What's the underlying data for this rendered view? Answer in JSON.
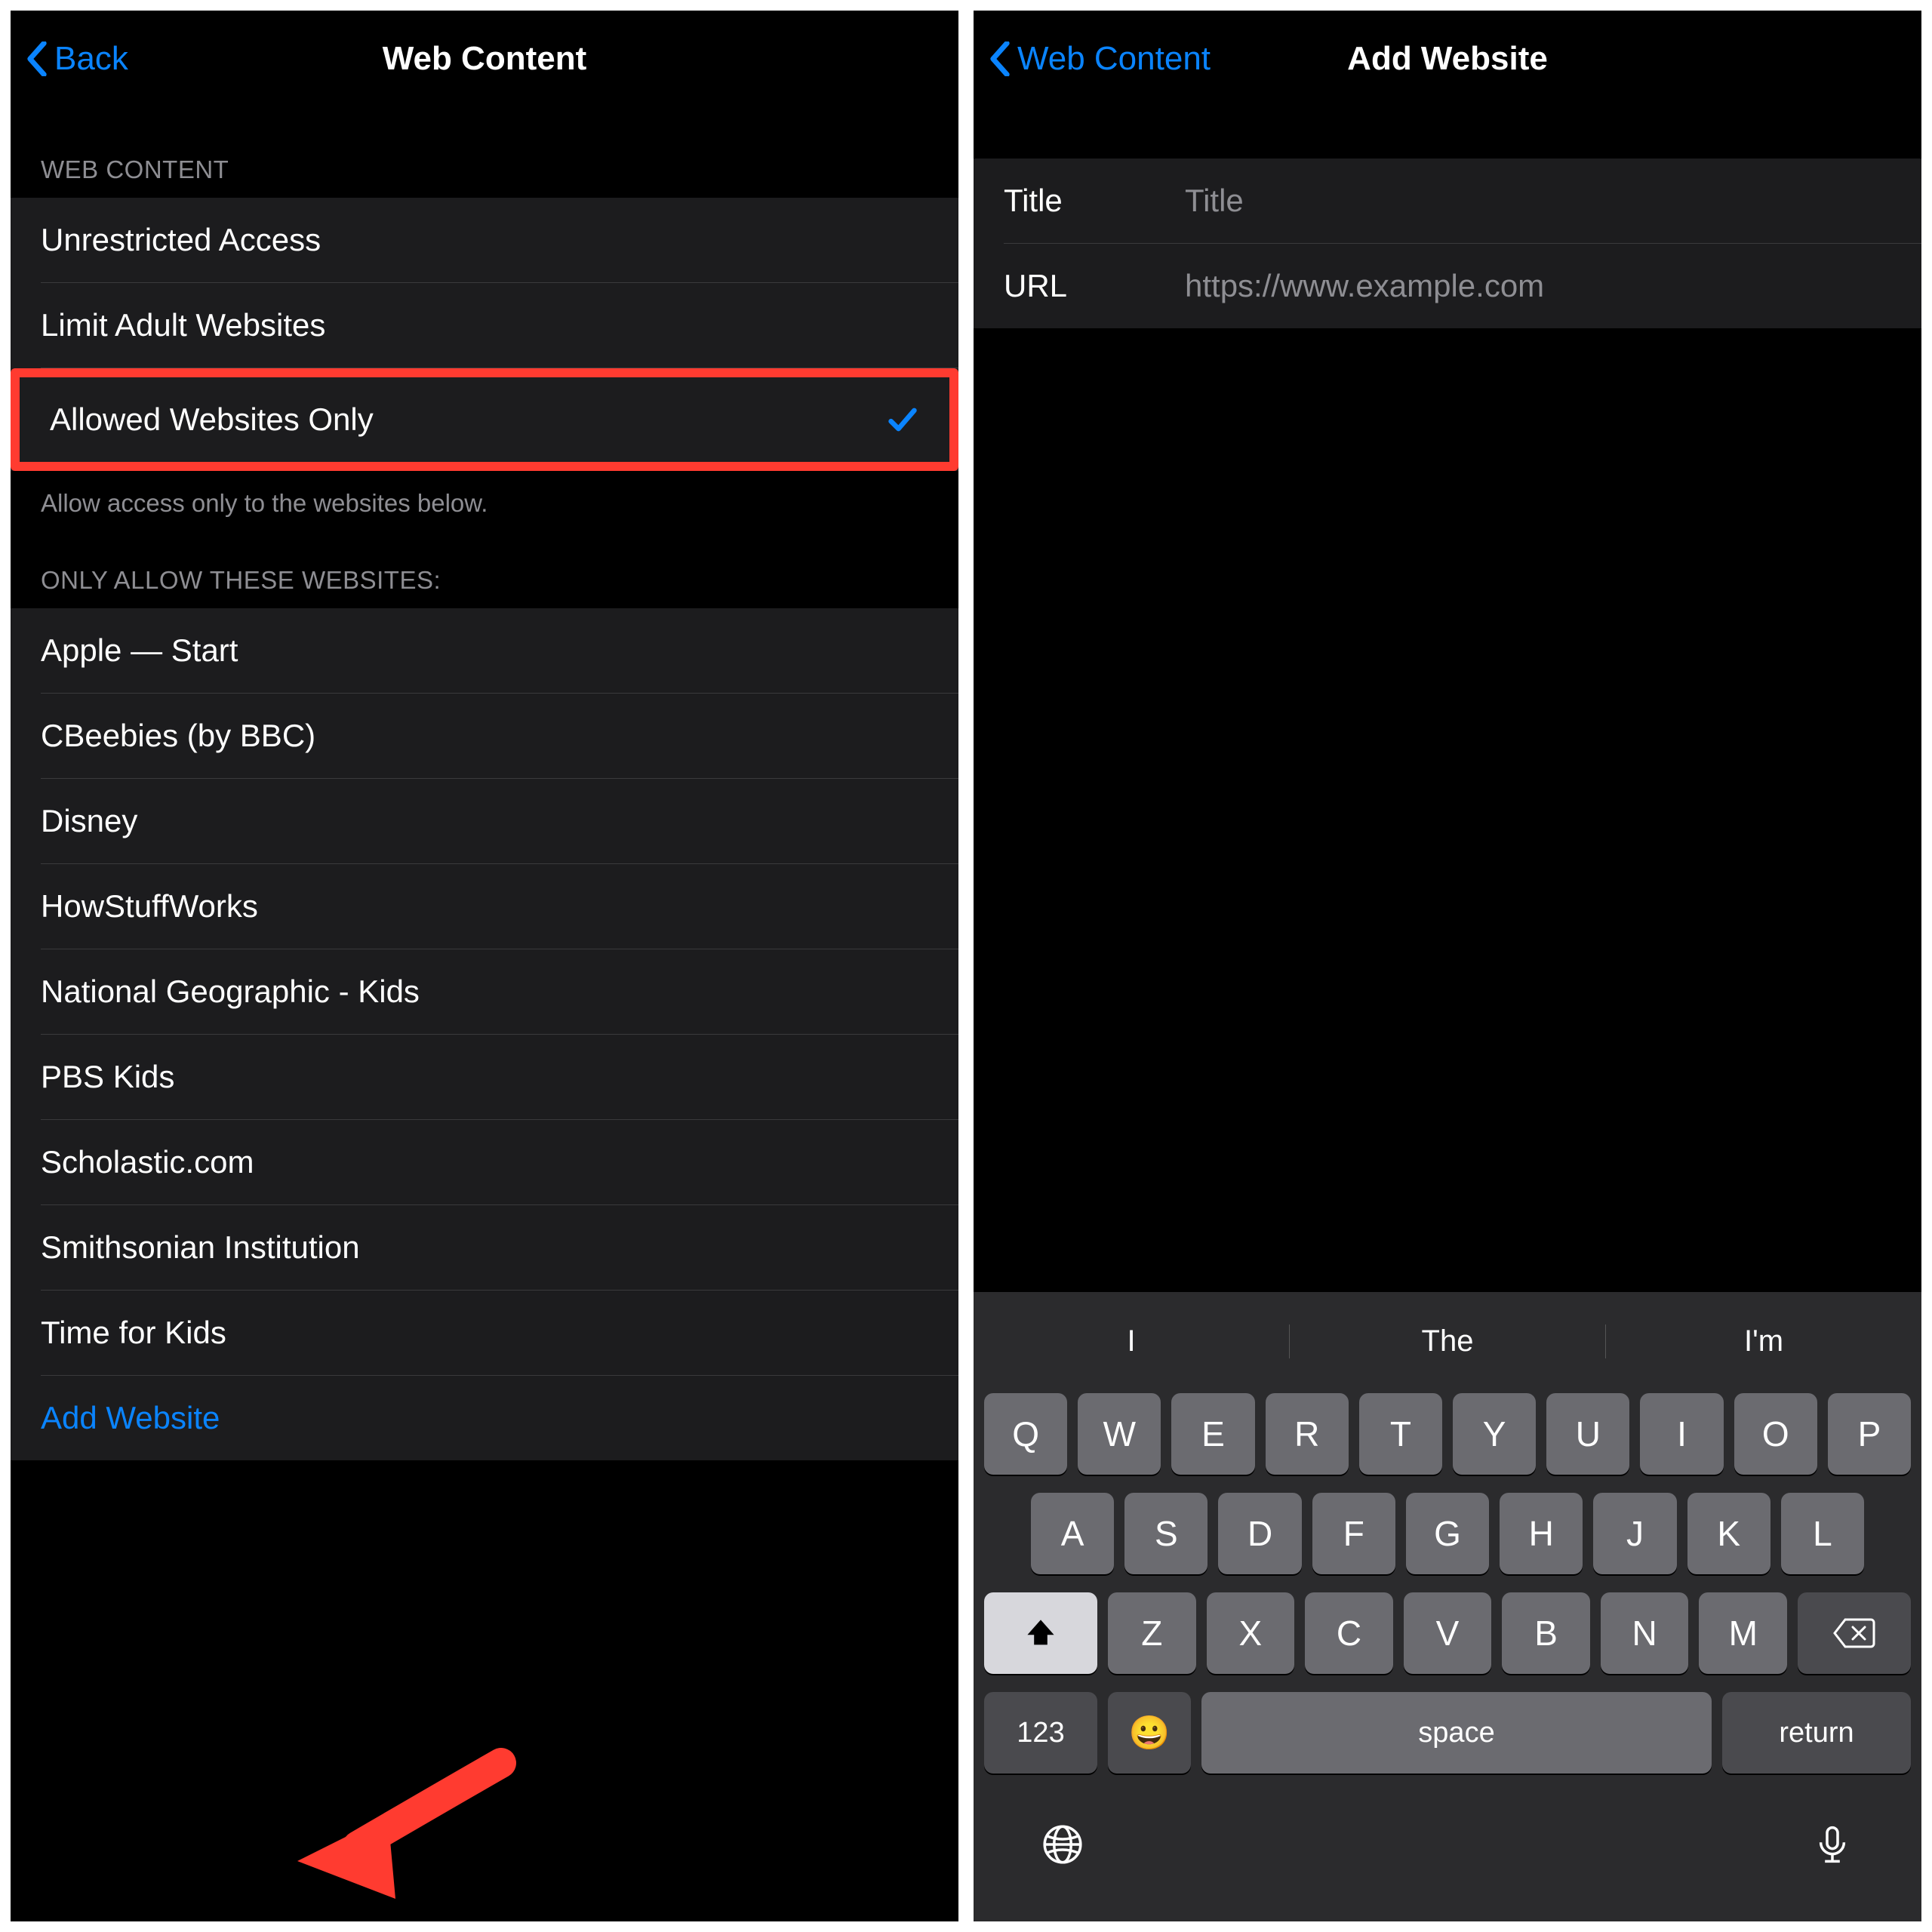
{
  "colors": {
    "accent": "#0a84ff",
    "highlight": "#ff3b30",
    "bg": "#000000",
    "cell": "#1c1c1e",
    "secondary": "#8e8e93"
  },
  "left": {
    "nav": {
      "back": "Back",
      "title": "Web Content"
    },
    "section1": {
      "header": "WEB CONTENT",
      "options": [
        {
          "label": "Unrestricted Access",
          "checked": false
        },
        {
          "label": "Limit Adult Websites",
          "checked": false
        },
        {
          "label": "Allowed Websites Only",
          "checked": true,
          "highlight": true
        }
      ],
      "footer": "Allow access only to the websites below."
    },
    "section2": {
      "header": "ONLY ALLOW THESE WEBSITES:",
      "sites": [
        "Apple — Start",
        "CBeebies (by BBC)",
        "Disney",
        "HowStuffWorks",
        "National Geographic - Kids",
        "PBS Kids",
        "Scholastic.com",
        "Smithsonian Institution",
        "Time for Kids"
      ],
      "add": "Add Website"
    }
  },
  "right": {
    "nav": {
      "back": "Web Content",
      "title": "Add Website"
    },
    "form": {
      "titleLabel": "Title",
      "titlePlaceholder": "Title",
      "urlLabel": "URL",
      "urlPlaceholder": "https://www.example.com"
    },
    "keyboard": {
      "suggestions": [
        "I",
        "The",
        "I'm"
      ],
      "row1": [
        "Q",
        "W",
        "E",
        "R",
        "T",
        "Y",
        "U",
        "I",
        "O",
        "P"
      ],
      "row2": [
        "A",
        "S",
        "D",
        "F",
        "G",
        "H",
        "J",
        "K",
        "L"
      ],
      "row3": [
        "Z",
        "X",
        "C",
        "V",
        "B",
        "N",
        "M"
      ],
      "numKey": "123",
      "spaceKey": "space",
      "returnKey": "return"
    }
  }
}
